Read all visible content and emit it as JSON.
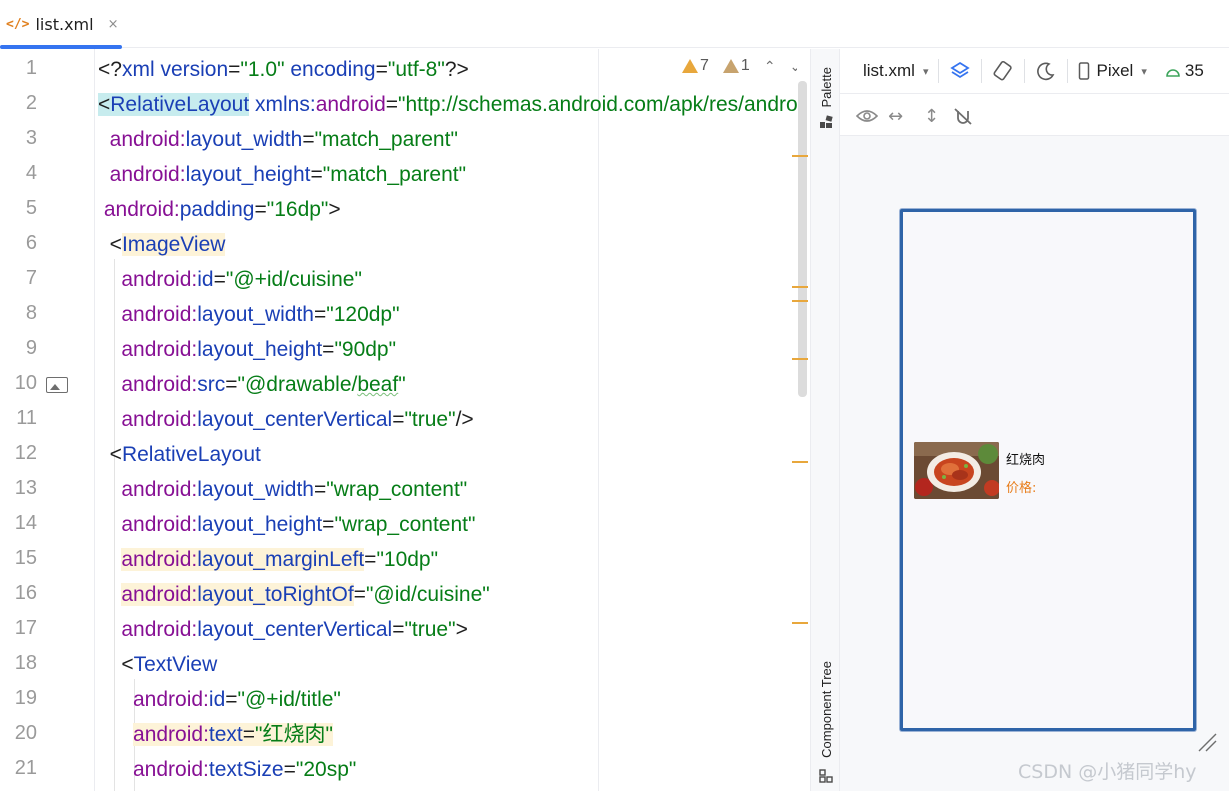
{
  "tab": {
    "icon": "</>",
    "label": "list.xml",
    "close": "×"
  },
  "editor": {
    "line_numbers": [
      "1",
      "2",
      "3",
      "4",
      "5",
      "6",
      "7",
      "8",
      "9",
      "10",
      "11",
      "12",
      "13",
      "14",
      "15",
      "16",
      "17",
      "18",
      "19",
      "20",
      "21"
    ],
    "inspections": {
      "warnings": "7",
      "weak_warnings": "1"
    },
    "lines": [
      [
        {
          "t": "<",
          "c": "c-punct"
        },
        {
          "t": "?",
          "c": "c-punct"
        },
        {
          "t": "xml version",
          "c": "c-attr2"
        },
        {
          "t": "=",
          "c": "c-punct"
        },
        {
          "t": "\"1.0\"",
          "c": "c-val"
        },
        {
          "t": " encoding",
          "c": "c-attr2"
        },
        {
          "t": "=",
          "c": "c-punct"
        },
        {
          "t": "\"utf-8\"",
          "c": "c-val"
        },
        {
          "t": "?>",
          "c": "c-punct"
        }
      ],
      [
        {
          "t": "<",
          "c": "c-punct hl-tag"
        },
        {
          "t": "RelativeLayout",
          "c": "c-tag hl-tag"
        },
        {
          "t": " xmlns:",
          "c": "c-attr2"
        },
        {
          "t": "android",
          "c": "c-attr"
        },
        {
          "t": "=",
          "c": "c-punct"
        },
        {
          "t": "\"http://schemas.android.com/apk/res/android\"",
          "c": "c-val"
        }
      ],
      [
        {
          "t": "  android:",
          "c": "c-attr"
        },
        {
          "t": "layout_width",
          "c": "c-attr2"
        },
        {
          "t": "=",
          "c": "c-punct"
        },
        {
          "t": "\"match_parent\"",
          "c": "c-val"
        }
      ],
      [
        {
          "t": "  android:",
          "c": "c-attr"
        },
        {
          "t": "layout_height",
          "c": "c-attr2"
        },
        {
          "t": "=",
          "c": "c-punct"
        },
        {
          "t": "\"match_parent\"",
          "c": "c-val"
        }
      ],
      [
        {
          "t": " android:",
          "c": "c-attr"
        },
        {
          "t": "padding",
          "c": "c-attr2"
        },
        {
          "t": "=",
          "c": "c-punct"
        },
        {
          "t": "\"16dp\"",
          "c": "c-val"
        },
        {
          "t": ">",
          "c": "c-punct"
        }
      ],
      [
        {
          "t": "  <",
          "c": "c-punct"
        },
        {
          "t": "ImageView",
          "c": "c-tag hl-attr"
        }
      ],
      [
        {
          "t": "    android:",
          "c": "c-attr"
        },
        {
          "t": "id",
          "c": "c-attr2"
        },
        {
          "t": "=",
          "c": "c-punct"
        },
        {
          "t": "\"@+id/cuisine\"",
          "c": "c-val"
        }
      ],
      [
        {
          "t": "    android:",
          "c": "c-attr"
        },
        {
          "t": "layout_width",
          "c": "c-attr2"
        },
        {
          "t": "=",
          "c": "c-punct"
        },
        {
          "t": "\"120dp\"",
          "c": "c-val"
        }
      ],
      [
        {
          "t": "    android:",
          "c": "c-attr"
        },
        {
          "t": "layout_height",
          "c": "c-attr2"
        },
        {
          "t": "=",
          "c": "c-punct"
        },
        {
          "t": "\"90dp\"",
          "c": "c-val"
        }
      ],
      [
        {
          "t": "    android:",
          "c": "c-attr"
        },
        {
          "t": "src",
          "c": "c-attr2"
        },
        {
          "t": "=",
          "c": "c-punct"
        },
        {
          "t": "\"@drawable/",
          "c": "c-val"
        },
        {
          "t": "beaf",
          "c": "c-val squiggle"
        },
        {
          "t": "\"",
          "c": "c-val"
        }
      ],
      [
        {
          "t": "    android:",
          "c": "c-attr"
        },
        {
          "t": "layout_centerVertical",
          "c": "c-attr2"
        },
        {
          "t": "=",
          "c": "c-punct"
        },
        {
          "t": "\"true\"",
          "c": "c-val"
        },
        {
          "t": "/>",
          "c": "c-punct"
        }
      ],
      [
        {
          "t": "  <",
          "c": "c-punct"
        },
        {
          "t": "RelativeLayout",
          "c": "c-tag"
        }
      ],
      [
        {
          "t": "    android:",
          "c": "c-attr"
        },
        {
          "t": "layout_width",
          "c": "c-attr2"
        },
        {
          "t": "=",
          "c": "c-punct"
        },
        {
          "t": "\"wrap_content\"",
          "c": "c-val"
        }
      ],
      [
        {
          "t": "    android:",
          "c": "c-attr"
        },
        {
          "t": "layout_height",
          "c": "c-attr2"
        },
        {
          "t": "=",
          "c": "c-punct"
        },
        {
          "t": "\"wrap_content\"",
          "c": "c-val"
        }
      ],
      [
        {
          "t": "    ",
          "c": "c-punct"
        },
        {
          "t": "android:",
          "c": "c-attr hl-attr"
        },
        {
          "t": "layout_marginLeft",
          "c": "c-attr2 hl-attr"
        },
        {
          "t": "=",
          "c": "c-punct"
        },
        {
          "t": "\"10dp\"",
          "c": "c-val"
        }
      ],
      [
        {
          "t": "    ",
          "c": "c-punct"
        },
        {
          "t": "android:",
          "c": "c-attr hl-attr"
        },
        {
          "t": "layout_toRightOf",
          "c": "c-attr2 hl-attr"
        },
        {
          "t": "=",
          "c": "c-punct"
        },
        {
          "t": "\"@id/cuisine\"",
          "c": "c-val"
        }
      ],
      [
        {
          "t": "    android:",
          "c": "c-attr"
        },
        {
          "t": "layout_centerVertical",
          "c": "c-attr2"
        },
        {
          "t": "=",
          "c": "c-punct"
        },
        {
          "t": "\"true\"",
          "c": "c-val"
        },
        {
          "t": ">",
          "c": "c-punct"
        }
      ],
      [
        {
          "t": "    <",
          "c": "c-punct"
        },
        {
          "t": "TextView",
          "c": "c-tag"
        }
      ],
      [
        {
          "t": "      android:",
          "c": "c-attr"
        },
        {
          "t": "id",
          "c": "c-attr2"
        },
        {
          "t": "=",
          "c": "c-punct"
        },
        {
          "t": "\"@+id/title\"",
          "c": "c-val"
        }
      ],
      [
        {
          "t": "      ",
          "c": "c-punct"
        },
        {
          "t": "android:",
          "c": "c-attr hl-attr"
        },
        {
          "t": "text",
          "c": "c-attr2 hl-attr"
        },
        {
          "t": "=",
          "c": "c-punct hl-attr"
        },
        {
          "t": "\"红烧肉\"",
          "c": "c-val hl-attr"
        }
      ],
      [
        {
          "t": "      android:",
          "c": "c-attr"
        },
        {
          "t": "textSize",
          "c": "c-attr2"
        },
        {
          "t": "=",
          "c": "c-punct"
        },
        {
          "t": "\"20sp\"",
          "c": "c-val"
        }
      ]
    ]
  },
  "side_strip": {
    "palette": "Palette",
    "component_tree": "Component Tree"
  },
  "design": {
    "file_select": "list.xml",
    "device_select": "Pixel",
    "api_level": "35",
    "preview": {
      "title": "红烧肉",
      "price_label": "价格:"
    }
  },
  "watermark": "CSDN @小猪同学hy",
  "colors": {
    "accent": "#3574f0",
    "warning": "#e8a73c",
    "price": "#e87e1c",
    "phone_border": "#2f64a8"
  }
}
